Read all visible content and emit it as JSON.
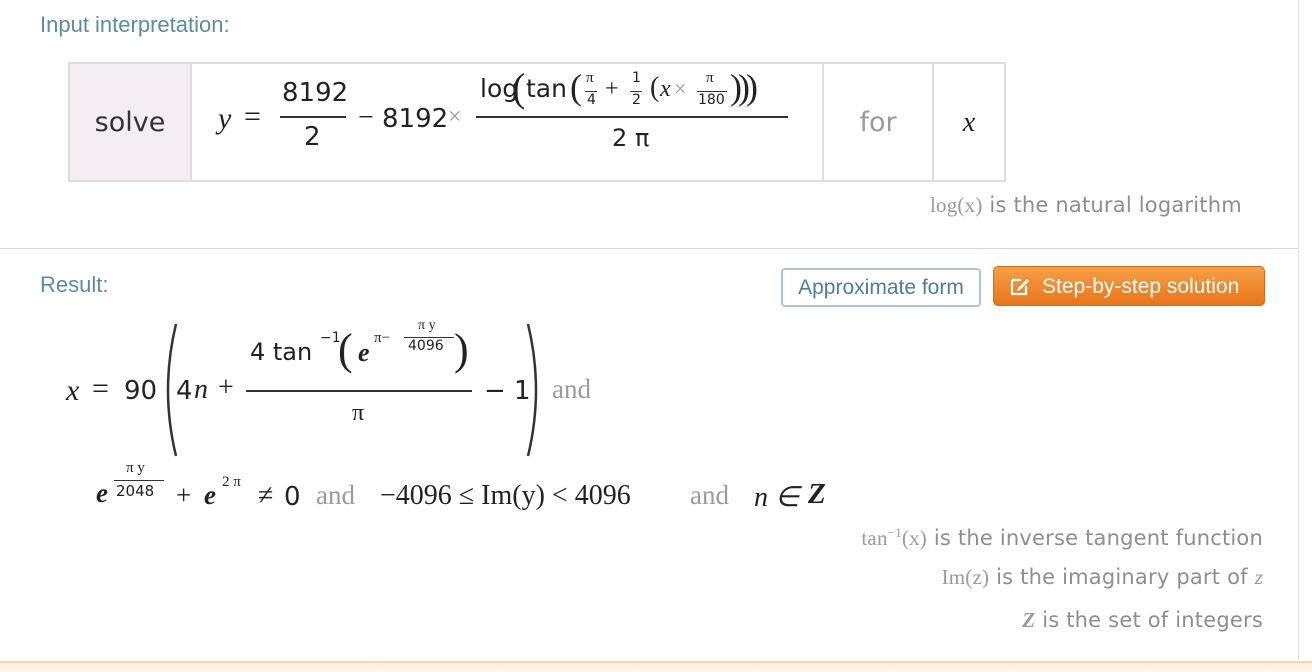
{
  "input_pod": {
    "title": "Input interpretation:",
    "solve_label": "solve",
    "for_label": "for",
    "variable": "x",
    "eq": {
      "lhs": "y",
      "eqsign": "=",
      "num1": "8192",
      "den1": "2",
      "minus": "−",
      "coef": "8192",
      "times": "×",
      "log": "log",
      "tan": "tan",
      "pi": "π",
      "four": "4",
      "plus": "+",
      "one": "1",
      "two": "2",
      "x": "x",
      "oneeighty": "180",
      "den2": "2 π"
    },
    "note": {
      "math": "log(x)",
      "text": "is the natural logarithm"
    }
  },
  "result_pod": {
    "title": "Result:",
    "approx_button": "Approximate form",
    "step_button": "Step-by-step solution",
    "line1": {
      "x": "x",
      "eq": "=",
      "ninety": "90",
      "four_n": "4",
      "n": "n",
      "plus": "+",
      "numer_tan": "4 tan",
      "sup_minus1": "−1",
      "e": "e",
      "exp_pi": "π−",
      "exp_piy": "π y",
      "exp_4096": "4096",
      "denom_pi": "π",
      "minus_one": "− 1",
      "and": "and"
    },
    "line2": {
      "e1": "e",
      "exp_piy": "π y",
      "exp_2048": "2048",
      "plus": "+",
      "e2": "e",
      "exp_2pi": "2 π",
      "neq": "≠",
      "zero": "0",
      "and1": "and",
      "range": "−4096 ≤ Im(y) < 4096",
      "and2": "and",
      "n_in": "n ∈",
      "Z": "Z"
    },
    "notes": [
      {
        "math": "tan",
        "sup": "−1",
        "math2": "(x)",
        "text": "is the inverse tangent function"
      },
      {
        "math": "Im(z)",
        "text": "is the imaginary part of",
        "tail": "z"
      },
      {
        "math": "Z",
        "text": "is the set of integers"
      }
    ]
  },
  "colors": {
    "pod_title": "#5b8ba6",
    "step_button": "#ef8a2c",
    "approx_border": "#a8c6d6",
    "solve_cell_bg": "#f4eef3"
  },
  "icons": {
    "step_button_icon": "pencil-edit-icon"
  }
}
